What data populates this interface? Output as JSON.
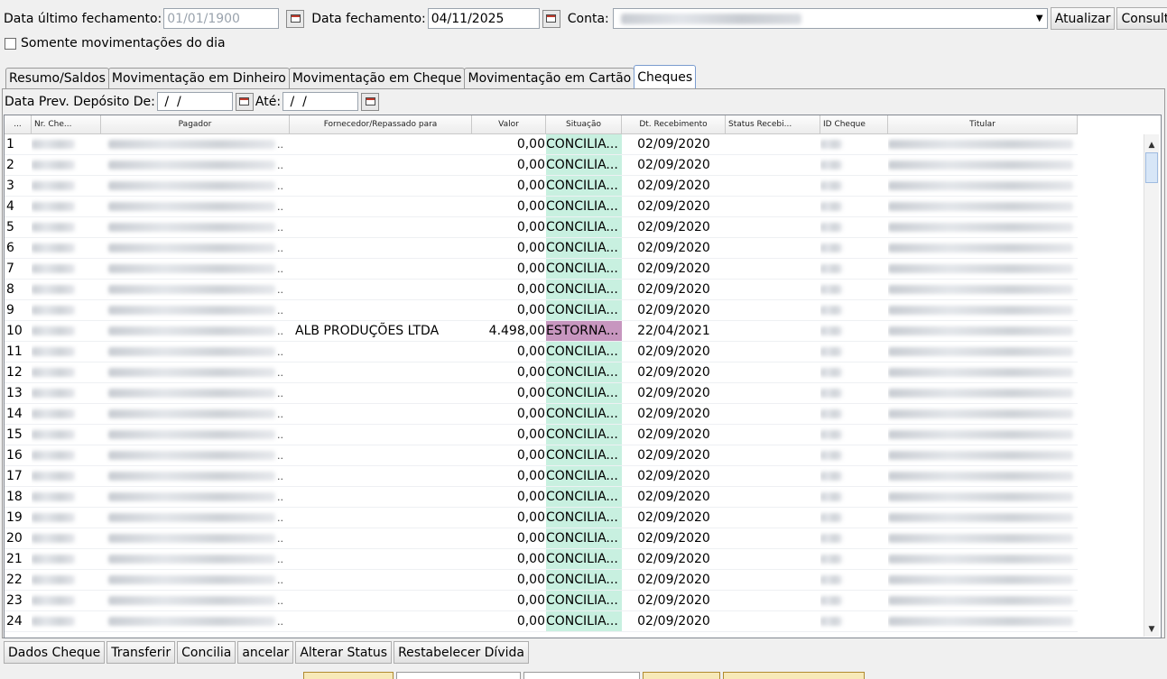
{
  "toolbar": {
    "last_close_label": "Data último fechamento:",
    "last_close_value": "01/01/1900",
    "close_label": "Data fechamento:",
    "close_value": "04/11/2025",
    "account_label": "Conta:",
    "update_button": "Atualizar",
    "query_button": "Consultar",
    "only_day_label": "Somente movimentações do dia"
  },
  "tabs": [
    {
      "label": "Resumo/Saldos"
    },
    {
      "label": "Movimentação em Dinheiro"
    },
    {
      "label": "Movimentação em Cheque"
    },
    {
      "label": "Movimentação em Cartão"
    },
    {
      "label": "Cheques"
    }
  ],
  "filter": {
    "from_label": "Data Prev. Depósito De:",
    "from_value": " /  /",
    "to_label": "Até:",
    "to_value": " /  /"
  },
  "grid": {
    "columns": [
      "...",
      "Nr. Che...",
      "Pagador",
      "Fornecedor/Repassado para",
      "Valor",
      "Situação",
      "Dt. Recebimento",
      "Status Recebi...",
      "ID Cheque",
      "Titular"
    ],
    "ellipsis": "..",
    "rows": [
      {
        "n": "1",
        "fornecedor": "",
        "valor": "0,00",
        "situacao": "CONCILIA...",
        "status": "ok",
        "dt": "02/09/2020"
      },
      {
        "n": "2",
        "fornecedor": "",
        "valor": "0,00",
        "situacao": "CONCILIA...",
        "status": "ok",
        "dt": "02/09/2020"
      },
      {
        "n": "3",
        "fornecedor": "",
        "valor": "0,00",
        "situacao": "CONCILIA...",
        "status": "ok",
        "dt": "02/09/2020"
      },
      {
        "n": "4",
        "fornecedor": "",
        "valor": "0,00",
        "situacao": "CONCILIA...",
        "status": "ok",
        "dt": "02/09/2020"
      },
      {
        "n": "5",
        "fornecedor": "",
        "valor": "0,00",
        "situacao": "CONCILIA...",
        "status": "ok",
        "dt": "02/09/2020"
      },
      {
        "n": "6",
        "fornecedor": "",
        "valor": "0,00",
        "situacao": "CONCILIA...",
        "status": "ok",
        "dt": "02/09/2020"
      },
      {
        "n": "7",
        "fornecedor": "",
        "valor": "0,00",
        "situacao": "CONCILIA...",
        "status": "ok",
        "dt": "02/09/2020"
      },
      {
        "n": "8",
        "fornecedor": "",
        "valor": "0,00",
        "situacao": "CONCILIA...",
        "status": "ok",
        "dt": "02/09/2020"
      },
      {
        "n": "9",
        "fornecedor": "",
        "valor": "0,00",
        "situacao": "CONCILIA...",
        "status": "ok",
        "dt": "02/09/2020"
      },
      {
        "n": "10",
        "fornecedor": "ALB PRODUÇÕES LTDA",
        "valor": "4.498,00",
        "situacao": "ESTORNA...",
        "status": "est",
        "dt": "22/04/2021"
      },
      {
        "n": "11",
        "fornecedor": "",
        "valor": "0,00",
        "situacao": "CONCILIA...",
        "status": "ok",
        "dt": "02/09/2020"
      },
      {
        "n": "12",
        "fornecedor": "",
        "valor": "0,00",
        "situacao": "CONCILIA...",
        "status": "ok",
        "dt": "02/09/2020"
      },
      {
        "n": "13",
        "fornecedor": "",
        "valor": "0,00",
        "situacao": "CONCILIA...",
        "status": "ok",
        "dt": "02/09/2020"
      },
      {
        "n": "14",
        "fornecedor": "",
        "valor": "0,00",
        "situacao": "CONCILIA...",
        "status": "ok",
        "dt": "02/09/2020"
      },
      {
        "n": "15",
        "fornecedor": "",
        "valor": "0,00",
        "situacao": "CONCILIA...",
        "status": "ok",
        "dt": "02/09/2020"
      },
      {
        "n": "16",
        "fornecedor": "",
        "valor": "0,00",
        "situacao": "CONCILIA...",
        "status": "ok",
        "dt": "02/09/2020"
      },
      {
        "n": "17",
        "fornecedor": "",
        "valor": "0,00",
        "situacao": "CONCILIA...",
        "status": "ok",
        "dt": "02/09/2020"
      },
      {
        "n": "18",
        "fornecedor": "",
        "valor": "0,00",
        "situacao": "CONCILIA...",
        "status": "ok",
        "dt": "02/09/2020"
      },
      {
        "n": "19",
        "fornecedor": "",
        "valor": "0,00",
        "situacao": "CONCILIA...",
        "status": "ok",
        "dt": "02/09/2020"
      },
      {
        "n": "20",
        "fornecedor": "",
        "valor": "0,00",
        "situacao": "CONCILIA...",
        "status": "ok",
        "dt": "02/09/2020"
      },
      {
        "n": "21",
        "fornecedor": "",
        "valor": "0,00",
        "situacao": "CONCILIA...",
        "status": "ok",
        "dt": "02/09/2020"
      },
      {
        "n": "22",
        "fornecedor": "",
        "valor": "0,00",
        "situacao": "CONCILIA...",
        "status": "ok",
        "dt": "02/09/2020"
      },
      {
        "n": "23",
        "fornecedor": "",
        "valor": "0,00",
        "situacao": "CONCILIA...",
        "status": "ok",
        "dt": "02/09/2020"
      },
      {
        "n": "24",
        "fornecedor": "",
        "valor": "0,00",
        "situacao": "CONCILIA...",
        "status": "ok",
        "dt": "02/09/2020"
      }
    ]
  },
  "actions": [
    {
      "label": "Dados Cheque"
    },
    {
      "label": "Transferir"
    },
    {
      "label": "Concilia"
    },
    {
      "label": "ancelar"
    },
    {
      "label": "Alterar Status"
    },
    {
      "label": "Restabelecer Dívida"
    }
  ],
  "colors": {
    "conciliado_bg": "#c8f0e0",
    "estornado_bg": "#c796bf",
    "active_tab_border": "#7a9ccf"
  }
}
